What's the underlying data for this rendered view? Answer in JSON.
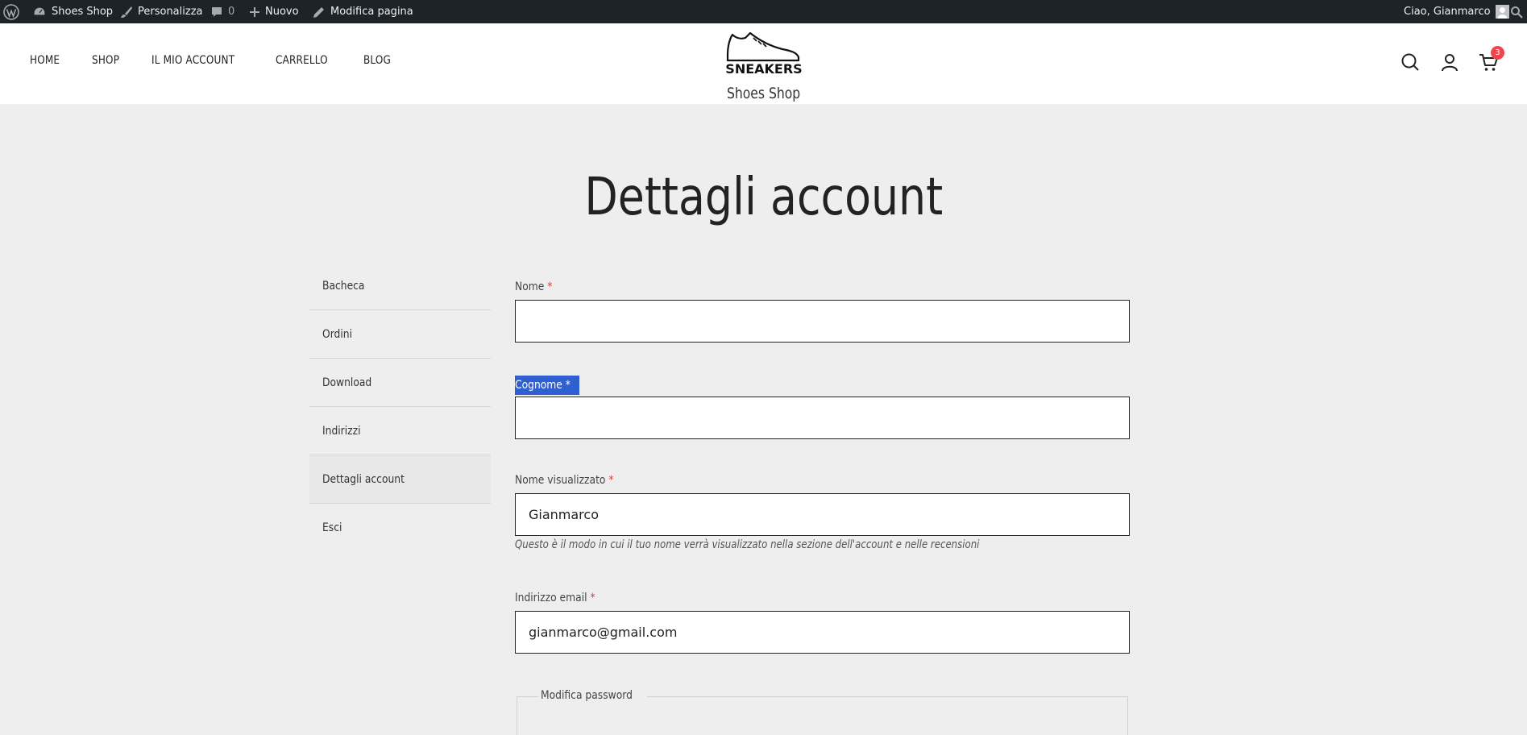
{
  "adminbar": {
    "site_name": "Shoes Shop",
    "customize": "Personalizza",
    "comments_count": "0",
    "new": "Nuovo",
    "edit_page": "Modifica pagina",
    "greeting": "Ciao, Gianmarco"
  },
  "header": {
    "nav": [
      "HOME",
      "SHOP",
      "IL MIO ACCOUNT",
      "CARRELLO",
      "BLOG"
    ],
    "logo_text": "SNEAKERS",
    "site_title": "Shoes Shop",
    "cart_count": "3"
  },
  "page": {
    "title": "Dettagli account"
  },
  "sidebar": {
    "items": [
      "Bacheca",
      "Ordini",
      "Download",
      "Indirizzi",
      "Dettagli account",
      "Esci"
    ],
    "active": "Dettagli account"
  },
  "form": {
    "nome_label": "Nome",
    "nome_value": "",
    "cognome_label": "Cognome",
    "cognome_value": "",
    "display_name_label": "Nome visualizzato",
    "display_name_value": "Gianmarco",
    "display_name_hint": "Questo è il modo in cui il tuo nome verrà visualizzato nella sezione dell'account e nelle recensioni",
    "email_label": "Indirizzo email",
    "email_value": "gianmarco@gmail.com",
    "password_legend": "Modifica password",
    "required_mark": "*"
  },
  "colors": {
    "adminbar_bg": "#1d2327",
    "page_bg": "#eeeeee",
    "required": "#e2401c",
    "badge": "#f0474e",
    "selection": "#2f5fd1"
  }
}
